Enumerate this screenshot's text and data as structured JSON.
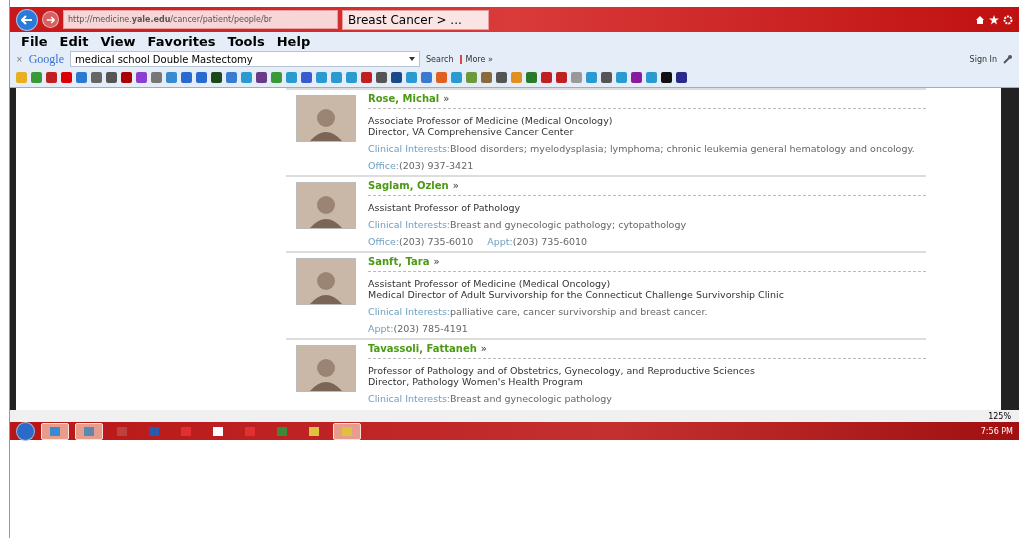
{
  "browser": {
    "address": "http://medicine.**yale.edu**/cancer/patient/people/br",
    "tab": {
      "title": "Breast Cancer > ...",
      "selected": true
    }
  },
  "menu": [
    "File",
    "Edit",
    "View",
    "Favorites",
    "Tools",
    "Help"
  ],
  "google_bar": {
    "close": "×",
    "logo": "Google",
    "query": "medical school Double Mastectomy",
    "search": "Search",
    "more": "More »",
    "sign_in": "Sign In"
  },
  "people": [
    {
      "name": "Rose, Michal",
      "mark": "»",
      "titles": [
        "Associate Professor of Medicine (Medical Oncology)",
        "Director, VA Comprehensive Cancer Center"
      ],
      "interests": {
        "label": "Clinical Interests:",
        "value": "Blood disorders; myelodysplasia; lymphoma; chronic leukemia general hematology and oncology."
      },
      "contacts": [
        {
          "label": "Office:",
          "value": "(203) 937-3421"
        }
      ]
    },
    {
      "name": "Saglam, Ozlen",
      "mark": "»",
      "titles": [
        "Assistant Professor of Pathology"
      ],
      "interests": {
        "label": "Clinical Interests:",
        "value": "Breast and gynecologic pathology; cytopathology"
      },
      "contacts": [
        {
          "label": "Office:",
          "value": "(203) 735-6010"
        },
        {
          "label": "Appt:",
          "value": "(203) 735-6010"
        }
      ]
    },
    {
      "name": "Sanft, Tara",
      "mark": "»",
      "titles": [
        "Assistant Professor of Medicine (Medical Oncology)",
        "Medical Director of Adult Survivorship for the Connecticut Challenge Survivorship Clinic"
      ],
      "interests": {
        "label": "Clinical Interests:",
        "value": "palliative care, cancer survivorship and breast cancer."
      },
      "contacts": [
        {
          "label": "Appt:",
          "value": "(203) 785-4191"
        }
      ]
    },
    {
      "name": "Tavassoli, Fattaneh",
      "mark": "»",
      "titles": [
        "Professor of Pathology and of Obstetrics, Gynecology, and Reproductive Sciences",
        "Director, Pathology Women's Health Program"
      ],
      "interests": {
        "label": "Clinical Interests:",
        "value": "Breast and gynecologic pathology"
      }
    }
  ],
  "status_bar": {
    "zoom": "125%"
  },
  "taskbar": {
    "time": "7:56 PM"
  }
}
